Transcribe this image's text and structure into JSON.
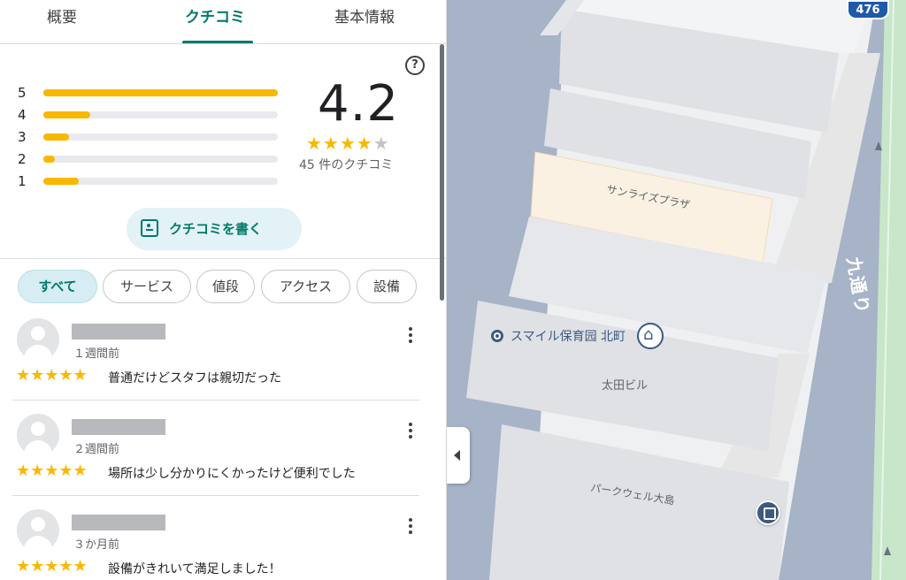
{
  "tabs": {
    "overview": "概要",
    "reviews": "クチコミ",
    "info": "基本情報"
  },
  "rating": {
    "average": "4.2",
    "count_text": "45 件のクチコミ",
    "stars": "★★★★",
    "stars_off": "★",
    "distribution": [
      {
        "label": "5",
        "fraction": 1.0
      },
      {
        "label": "4",
        "fraction": 0.2
      },
      {
        "label": "3",
        "fraction": 0.11
      },
      {
        "label": "2",
        "fraction": 0.05
      },
      {
        "label": "1",
        "fraction": 0.15
      }
    ]
  },
  "write_review": {
    "label": "クチコミを書く",
    "icon": "write-review-icon"
  },
  "help": {
    "icon": "help-icon",
    "glyph": "?"
  },
  "filters": [
    "すべて",
    "サービス",
    "値段",
    "アクセス",
    "設備"
  ],
  "active_filter": "すべて",
  "reviews": [
    {
      "time": "１週間前",
      "stars": "★★★★★",
      "text": "普通だけどスタフは親切だった"
    },
    {
      "time": "２週間前",
      "stars": "★★★★★",
      "text": "場所は少し分かりにくかったけど便利でした"
    },
    {
      "time": "３か月前",
      "stars": "★★★★★",
      "text": "設備がきれいて満足しました！"
    }
  ],
  "map": {
    "route_number": "476",
    "road_name": "九通り",
    "labels": {
      "sunrise": "サンライズプラザ",
      "poi": "スマイル保育园 北町",
      "ota": "太田ビル",
      "parkwell": "パークウェル大島"
    }
  },
  "colors": {
    "accent": "#00796b",
    "star": "#f9b800",
    "map_road": "#a7b3c7",
    "map_block": "#dfe1e5",
    "map_poi": "#3d5a80",
    "park": "#c8e6c9"
  }
}
